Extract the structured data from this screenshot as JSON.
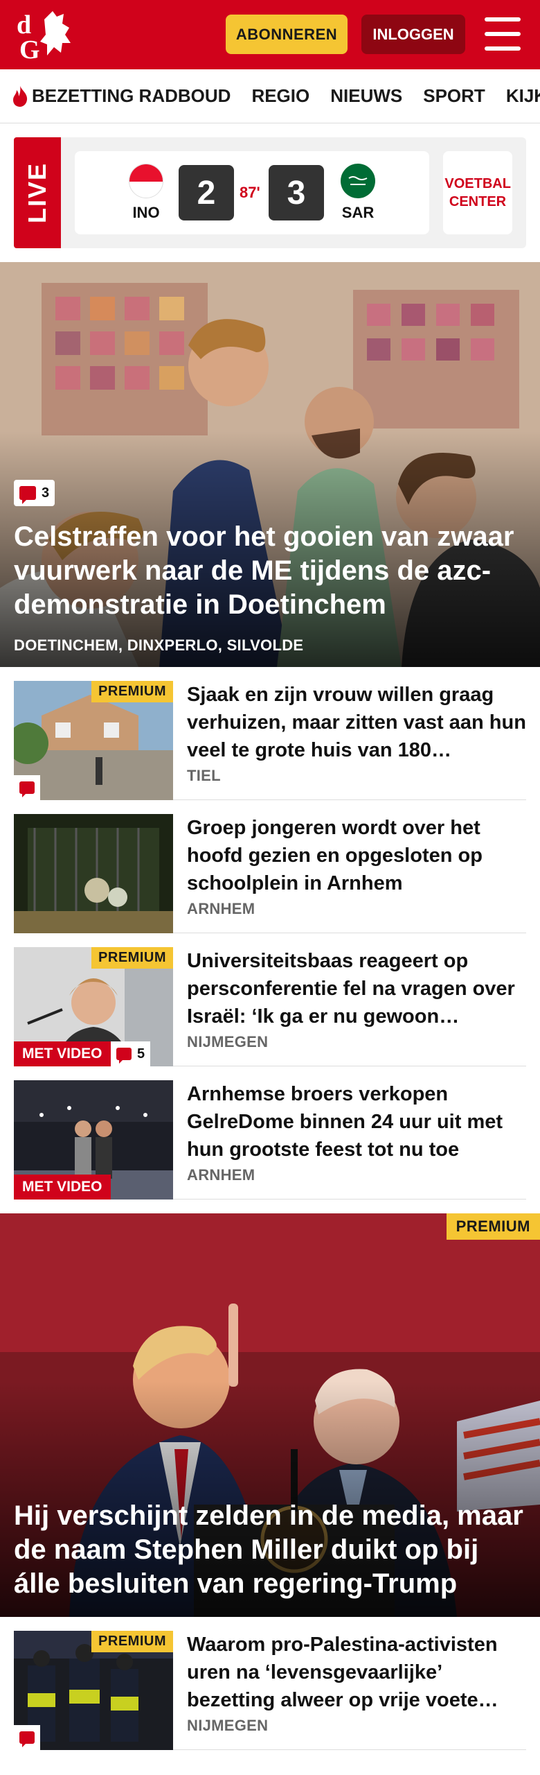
{
  "header": {
    "logo_text": "dG",
    "subscribe_label": "ABONNEREN",
    "login_label": "INLOGGEN"
  },
  "nav": {
    "items": [
      "BEZETTING RADBOUD",
      "REGIO",
      "NIEUWS",
      "SPORT",
      "KIJK"
    ]
  },
  "live": {
    "label": "LIVE",
    "home_team": "INO",
    "away_team": "SAR",
    "home_score": "2",
    "away_score": "3",
    "minute": "87'",
    "center_label": "VOETBAL CENTER"
  },
  "hero": {
    "comments": "3",
    "title": "Celstraffen voor het gooien van zwaar vuurwerk naar de ME tijdens de azc-demonstratie in Doetinchem",
    "locations": "DOETINCHEM, DINXPERLO, SILVOLDE"
  },
  "articles": [
    {
      "title": "Sjaak en zijn vrouw willen graag verhuizen, maar zitten vast aan hun veel te grote huis van 180…",
      "location": "TIEL",
      "premium": "PREMIUM",
      "video": "",
      "comments": ""
    },
    {
      "title": "Groep jongeren wordt over het hoofd gezien en opgesloten op schoolplein in Arnhem",
      "location": "ARNHEM",
      "premium": "",
      "video": "",
      "comments": ""
    },
    {
      "title": "Universiteitsbaas reageert op persconferentie fel na vragen over Israël: ‘Ik ga er nu gewoon…",
      "location": "NIJMEGEN",
      "premium": "PREMIUM",
      "video": "MET VIDEO",
      "comments": "5"
    },
    {
      "title": "Arnhemse broers verkopen GelreDome binnen 24 uur uit met hun grootste feest tot nu toe",
      "location": "ARNHEM",
      "premium": "",
      "video": "MET VIDEO",
      "comments": ""
    }
  ],
  "hero2": {
    "premium": "PREMIUM",
    "title": "Hij verschijnt zelden in de media, maar de naam Stephen Miller duikt op bij álle besluiten van regering-Trump"
  },
  "article5": {
    "title": "Waarom pro-Palestina-activisten uren na ‘levensgevaarlijke’ bezetting alweer op vrije voete…",
    "location": "NIJMEGEN",
    "premium": "PREMIUM"
  },
  "colors": {
    "brand": "#d0021b",
    "premium": "#f5c533"
  }
}
